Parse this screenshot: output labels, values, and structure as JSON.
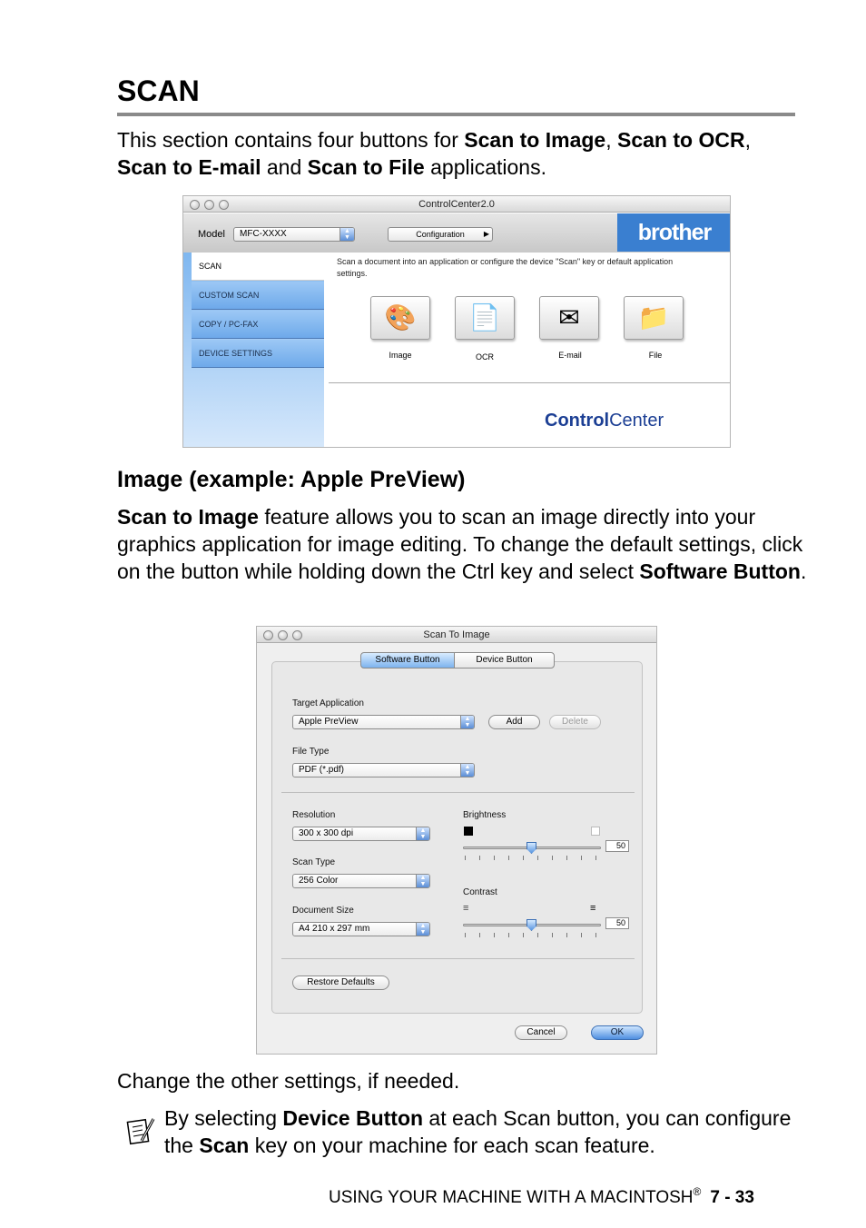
{
  "section": {
    "title": "SCAN",
    "intro": [
      {
        "t": "This section contains four buttons for ",
        "b": false
      },
      {
        "t": "Scan to Image",
        "b": true
      },
      {
        "t": ", ",
        "b": false
      },
      {
        "t": "Scan to OCR",
        "b": true
      },
      {
        "t": ", ",
        "b": false
      },
      {
        "t": "Scan to E-mail",
        "b": true
      },
      {
        "t": " and ",
        "b": false
      },
      {
        "t": "Scan to File",
        "b": true
      },
      {
        "t": " applications.",
        "b": false
      }
    ]
  },
  "controlcenter": {
    "window_title": "ControlCenter2.0",
    "model_label": "Model",
    "model_value": "MFC-XXXX",
    "config_label": "Configuration",
    "brand": "brother",
    "sidebar": [
      "SCAN",
      "CUSTOM SCAN",
      "COPY / PC-FAX",
      "DEVICE SETTINGS"
    ],
    "description": "Scan a document into an application or configure the device \"Scan\" key or default application settings.",
    "buttons": [
      {
        "label": "Image",
        "icon": "image-icon"
      },
      {
        "label": "OCR",
        "icon": "ocr-icon"
      },
      {
        "label": "E-mail",
        "icon": "email-icon"
      },
      {
        "label": "File",
        "icon": "folder-icon"
      }
    ],
    "logo_bold": "Control",
    "logo_light": "Center"
  },
  "subsection": {
    "heading": "Image (example: Apple PreView)",
    "description": [
      {
        "t": "Scan to Image",
        "b": true
      },
      {
        "t": " feature allows you to scan an image directly into your graphics application for image editing. To change the default settings, click on the button while holding down the Ctrl key and select ",
        "b": false
      },
      {
        "t": "Software Button",
        "b": true
      },
      {
        "t": ".",
        "b": false
      }
    ]
  },
  "scan_to_image": {
    "window_title": "Scan To Image",
    "tabs": [
      "Software Button",
      "Device Button"
    ],
    "target_app_label": "Target Application",
    "target_app_value": "Apple PreView",
    "add_label": "Add",
    "delete_label": "Delete",
    "file_type_label": "File Type",
    "file_type_value": "PDF (*.pdf)",
    "resolution_label": "Resolution",
    "resolution_value": "300 x 300 dpi",
    "scan_type_label": "Scan Type",
    "scan_type_value": "256 Color",
    "doc_size_label": "Document Size",
    "doc_size_value": "A4 210 x 297 mm",
    "brightness_label": "Brightness",
    "brightness_value": "50",
    "contrast_label": "Contrast",
    "contrast_value": "50",
    "restore_label": "Restore Defaults",
    "cancel_label": "Cancel",
    "ok_label": "OK"
  },
  "after_text": "Change the other settings, if needed.",
  "note": [
    {
      "t": "By selecting ",
      "b": false
    },
    {
      "t": "Device Button",
      "b": true
    },
    {
      "t": " at each Scan button, you can configure the ",
      "b": false
    },
    {
      "t": "Scan",
      "b": true
    },
    {
      "t": " key on your machine for each scan feature.",
      "b": false
    }
  ],
  "footer": {
    "text": "USING YOUR MACHINE WITH A MACINTOSH",
    "reg": "®",
    "page": "7 - 33"
  }
}
